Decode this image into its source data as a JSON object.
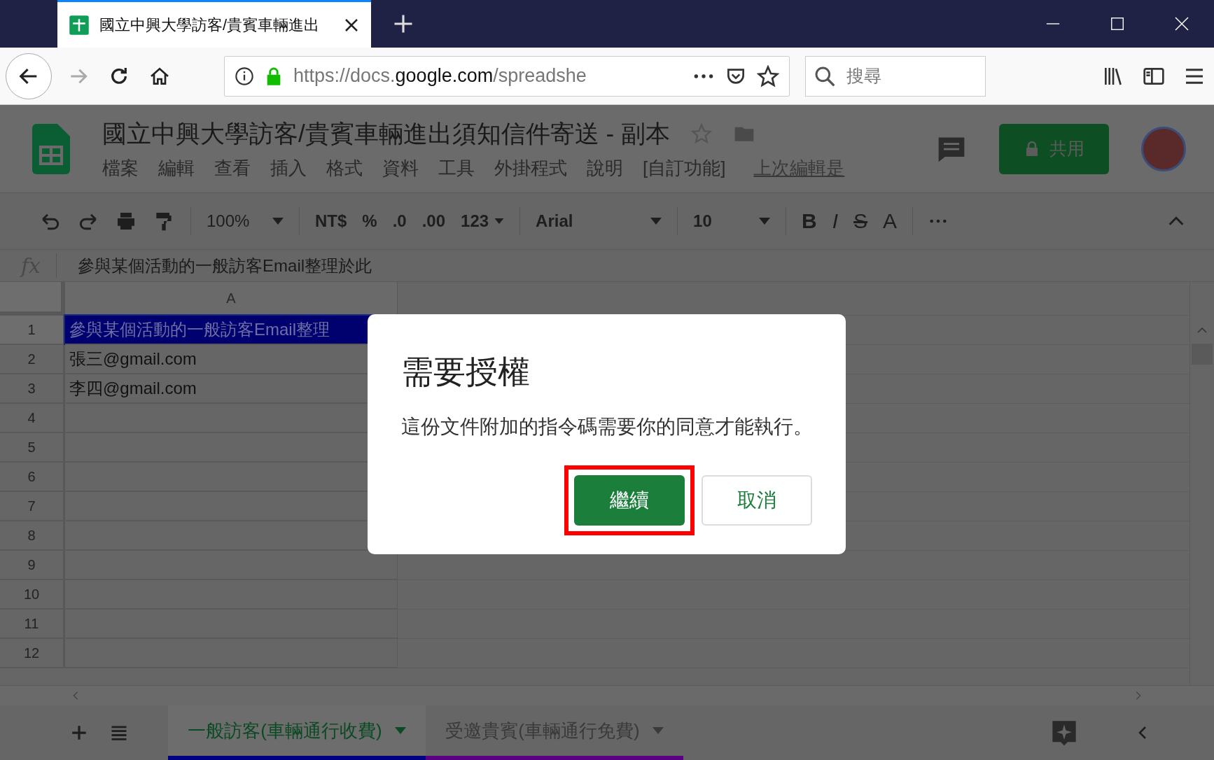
{
  "browser": {
    "tab": {
      "title": "國立中興大學訪客/貴賓車輛進出"
    },
    "url": {
      "scheme": "https://docs.",
      "domain": "google.com",
      "path": "/spreadshe"
    },
    "search": {
      "placeholder": "搜尋"
    }
  },
  "doc": {
    "title": "國立中興大學訪客/貴賓車輛進出須知信件寄送 - 副本",
    "menu": [
      "檔案",
      "編輯",
      "查看",
      "插入",
      "格式",
      "資料",
      "工具",
      "外掛程式",
      "說明",
      "[自訂功能]"
    ],
    "last_edit": "上次編輯是",
    "share": "共用"
  },
  "toolbar": {
    "zoom": "100%",
    "currency": "NT$",
    "percent": "%",
    "decrease_decimal": ".0",
    "increase_decimal": ".00",
    "number_format": "123",
    "font": "Arial",
    "font_size": "10",
    "bold": "B",
    "italic": "I",
    "strike": "S",
    "text_color": "A"
  },
  "formula_bar": {
    "label": "fx",
    "content": "參與某個活動的一般訪客Email整理於此"
  },
  "grid": {
    "column": "A",
    "rows": [
      {
        "number": "1",
        "value": "參與某個活動的一般訪客Email整理",
        "selected": true
      },
      {
        "number": "2",
        "value": "張三@gmail.com",
        "selected": false
      },
      {
        "number": "3",
        "value": "李四@gmail.com",
        "selected": false
      },
      {
        "number": "4",
        "selected": false
      },
      {
        "number": "5",
        "selected": false
      },
      {
        "number": "6",
        "selected": false
      },
      {
        "number": "7",
        "selected": false
      },
      {
        "number": "8",
        "selected": false
      },
      {
        "number": "9",
        "selected": false
      },
      {
        "number": "10",
        "selected": false
      },
      {
        "number": "11",
        "selected": false
      },
      {
        "number": "12",
        "selected": false
      }
    ]
  },
  "sheets": [
    {
      "label": "一般訪客(車輛通行收費)",
      "selected": true,
      "color": "#000080"
    },
    {
      "label": "受邀貴賓(車輛通行免費)",
      "selected": false,
      "color": "#5a0082"
    }
  ],
  "dialog": {
    "title": "需要授權",
    "message": "這份文件附加的指令碼需要你的同意才能執行。",
    "buttons": [
      {
        "label": "繼續",
        "kind": "primary",
        "highlighted": true
      },
      {
        "label": "取消",
        "kind": "secondary",
        "highlighted": false
      }
    ]
  }
}
